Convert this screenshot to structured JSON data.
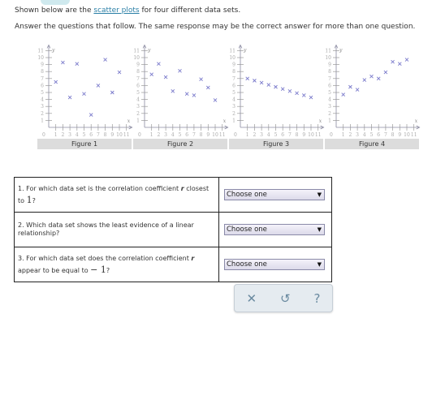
{
  "intro": {
    "prefix": "Shown below are the ",
    "link": "scatter plots",
    "suffix": " for four different data sets.",
    "line2": "Answer the questions that follow. The same response may be the correct answer for more than one question."
  },
  "figures": [
    {
      "caption": "Figure 1"
    },
    {
      "caption": "Figure 2"
    },
    {
      "caption": "Figure 3"
    },
    {
      "caption": "Figure 4"
    }
  ],
  "chart_data": [
    {
      "type": "scatter",
      "title": "Figure 1",
      "xlabel": "x",
      "ylabel": "y",
      "xlim": [
        0,
        11
      ],
      "ylim": [
        0,
        11
      ],
      "x": [
        1,
        2,
        3,
        4,
        5,
        6,
        7,
        8,
        9,
        10
      ],
      "y": [
        6.5,
        9.3,
        4.3,
        9.1,
        4.8,
        1.8,
        6.0,
        9.7,
        5.0,
        7.9
      ],
      "xticks": [
        1,
        2,
        3,
        4,
        5,
        6,
        7,
        8,
        9,
        10,
        11
      ],
      "yticks": [
        1,
        2,
        3,
        4,
        5,
        6,
        7,
        8,
        9,
        10,
        11
      ],
      "origin_label": "0",
      "marker": "x",
      "color": "#7a7acb"
    },
    {
      "type": "scatter",
      "title": "Figure 2",
      "xlabel": "x",
      "ylabel": "y",
      "xlim": [
        0,
        11
      ],
      "ylim": [
        0,
        11
      ],
      "x": [
        1,
        2,
        3,
        4,
        5,
        6,
        7,
        8,
        9,
        10
      ],
      "y": [
        7.6,
        9.1,
        7.2,
        5.2,
        8.1,
        4.8,
        4.6,
        6.9,
        5.7,
        3.9
      ],
      "xticks": [
        1,
        2,
        3,
        4,
        5,
        6,
        7,
        8,
        9,
        10,
        11
      ],
      "yticks": [
        1,
        2,
        3,
        4,
        5,
        6,
        7,
        8,
        9,
        10,
        11
      ],
      "origin_label": "0",
      "marker": "x",
      "color": "#7a7acb"
    },
    {
      "type": "scatter",
      "title": "Figure 3",
      "xlabel": "x",
      "ylabel": "y",
      "xlim": [
        0,
        11
      ],
      "ylim": [
        0,
        11
      ],
      "x": [
        1,
        2,
        3,
        4,
        5,
        6,
        7,
        8,
        9,
        10
      ],
      "y": [
        7.0,
        6.7,
        6.4,
        6.1,
        5.8,
        5.5,
        5.2,
        4.9,
        4.6,
        4.3
      ],
      "xticks": [
        1,
        2,
        3,
        4,
        5,
        6,
        7,
        8,
        9,
        10,
        11
      ],
      "yticks": [
        1,
        2,
        3,
        4,
        5,
        6,
        7,
        8,
        9,
        10,
        11
      ],
      "origin_label": "0",
      "marker": "x",
      "color": "#7a7acb"
    },
    {
      "type": "scatter",
      "title": "Figure 4",
      "xlabel": "x",
      "ylabel": "y",
      "xlim": [
        0,
        11
      ],
      "ylim": [
        0,
        11
      ],
      "x": [
        1,
        2,
        3,
        4,
        5,
        6,
        7,
        8,
        9,
        10
      ],
      "y": [
        4.7,
        5.8,
        5.4,
        6.8,
        7.3,
        7.0,
        7.9,
        9.4,
        9.1,
        9.7
      ],
      "xticks": [
        1,
        2,
        3,
        4,
        5,
        6,
        7,
        8,
        9,
        10,
        11
      ],
      "yticks": [
        1,
        2,
        3,
        4,
        5,
        6,
        7,
        8,
        9,
        10,
        11
      ],
      "origin_label": "0",
      "marker": "x",
      "color": "#7a7acb"
    }
  ],
  "questions": [
    {
      "text_a": "1. For which data set is the correlation coefficient ",
      "r": "r",
      "text_b": " closest to ",
      "num": "1",
      "end": "?",
      "select": "Choose one"
    },
    {
      "text_a": "2. Which data set shows the least evidence of a linear relationship?",
      "r": "",
      "text_b": "",
      "num": "",
      "end": "",
      "select": "Choose one"
    },
    {
      "text_a": "3. For which data set does the correlation coefficient ",
      "r": "r",
      "text_b": " appear to be equal to ",
      "num": "− 1",
      "end": "?",
      "select": "Choose one"
    }
  ],
  "select_arrow": "▼",
  "tools": {
    "clear": "✕",
    "undo": "↺",
    "help": "?"
  }
}
